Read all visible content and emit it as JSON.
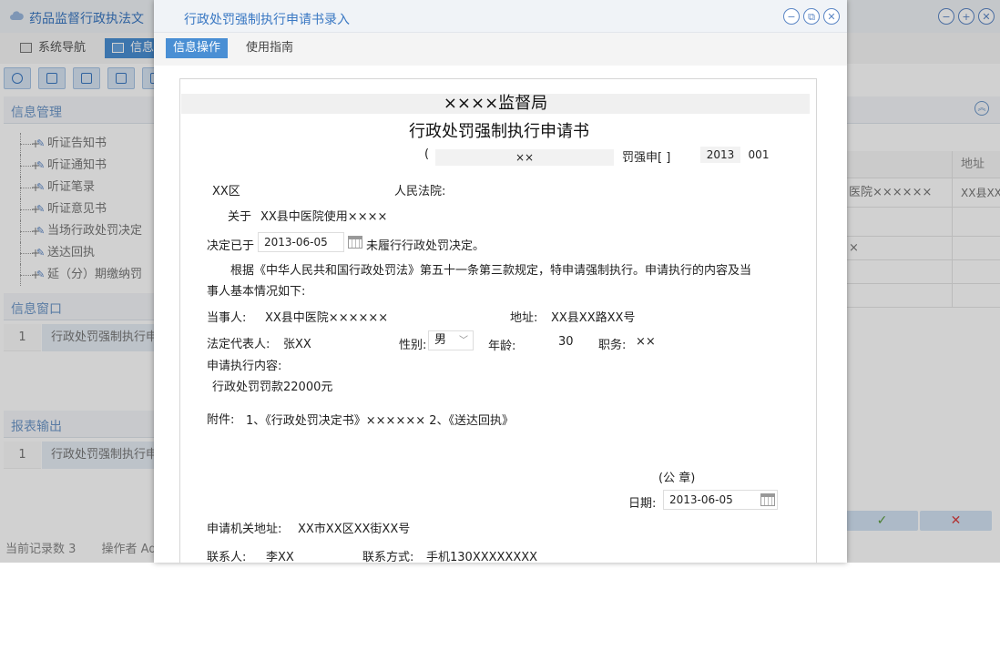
{
  "app": {
    "title": "药品监督行政执法文",
    "tabs": [
      "系统导航",
      "信息"
    ],
    "panels": {
      "info_mgmt": "信息管理",
      "info_window": "信息窗口",
      "report_output": "报表输出"
    },
    "tree_items": [
      "听证告知书",
      "听证通知书",
      "听证笔录",
      "听证意见书",
      "当场行政处罚决定",
      "送达回执",
      "延（分）期缴纳罚"
    ],
    "info_window_rows": [
      {
        "num": "1",
        "text": "行政处罚强制执行申"
      }
    ],
    "report_rows": [
      {
        "num": "1",
        "text": "行政处罚强制执行申"
      }
    ],
    "status": {
      "records": "当前记录数 3",
      "operator": "操作者 Ad"
    },
    "right_grid": {
      "header_addr": "地址",
      "rows": [
        {
          "c1": "医院××××××",
          "c2": "XX县XX"
        },
        {
          "c1": "×",
          "c2": ""
        },
        {
          "c1": "",
          "c2": ""
        },
        {
          "c1": "",
          "c2": ""
        }
      ],
      "confirm": "✓",
      "cancel": "✕"
    }
  },
  "modal": {
    "title": "行政处罚强制执行申请书录入",
    "tabs": {
      "info_ops": "信息操作",
      "guide": "使用指南"
    }
  },
  "document": {
    "org": "××××监督局",
    "title": "行政处罚强制执行申请书",
    "paren_open": "(",
    "code_field": "××",
    "code_suffix": "罚强申[ ]",
    "year": "2013",
    "serial": "001",
    "district": "XX区",
    "court": "人民法院:",
    "about_prefix": "关于",
    "about_text": "XX县中医院使用××××",
    "decision_prefix": "决定已于",
    "decision_date": "2013-06-05",
    "decision_suffix": "未履行行政处罚决定。",
    "basis_line1": "根据《中华人民共和国行政处罚法》第五十一条第三款规定，特申请强制执行。申请执行的内容及当",
    "basis_line2": "事人基本情况如下:",
    "party_label": "当事人:",
    "party_value": "XX县中医院××××××",
    "address_label": "地址:",
    "address_value": "XX县XX路XX号",
    "rep_label": "法定代表人:",
    "rep_value": "张XX",
    "gender_label": "性别:",
    "gender_value": "男",
    "age_label": "年龄:",
    "age_value": "30",
    "position_label": "职务:",
    "position_value": "××",
    "content_label": "申请执行内容:",
    "content_value": "行政处罚罚款22000元",
    "attach_label": "附件:",
    "attach_value": "1、《行政处罚决定书》×××××× 2、《送达回执》",
    "seal": "(公 章)",
    "date_label": "日期:",
    "date_value": "2013-06-05",
    "applicant_addr_label": "申请机关地址:",
    "applicant_addr_value": "XX市XX区XX街XX号",
    "contact_label": "联系人:",
    "contact_value": "李XX",
    "contact_method_label": "联系方式:",
    "contact_method_value": "手机130XXXXXXXX"
  }
}
